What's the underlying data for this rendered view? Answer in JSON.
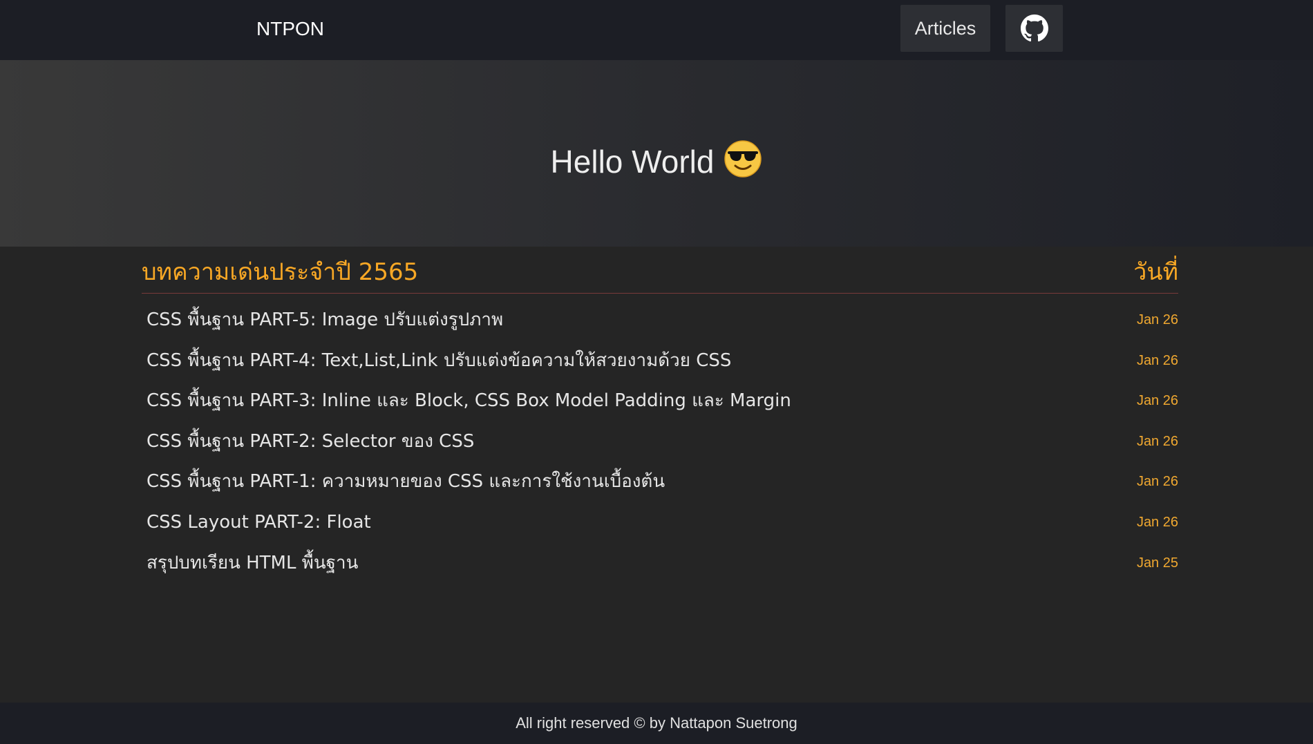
{
  "navbar": {
    "brand": "NTPON",
    "articles_label": "Articles",
    "github_icon": "github-icon"
  },
  "hero": {
    "title": "Hello World",
    "emoji_icon": "smiling-face-with-sunglasses-icon"
  },
  "section": {
    "title": "บทความเด่นประจำปี 2565",
    "date_header": "วันที่"
  },
  "articles": [
    {
      "title": "CSS พื้นฐาน PART-5: Image ปรับแต่งรูปภาพ",
      "date": "Jan 26"
    },
    {
      "title": "CSS พื้นฐาน PART-4: Text,List,Link ปรับแต่งข้อความให้สวยงามด้วย CSS",
      "date": "Jan 26"
    },
    {
      "title": "CSS พื้นฐาน PART-3: Inline และ Block, CSS Box Model Padding และ Margin",
      "date": "Jan 26"
    },
    {
      "title": "CSS พื้นฐาน PART-2: Selector ของ CSS",
      "date": "Jan 26"
    },
    {
      "title": "CSS พื้นฐาน PART-1: ความหมายของ CSS และการใช้งานเบื้องต้น",
      "date": "Jan 26"
    },
    {
      "title": "CSS Layout PART-2: Float",
      "date": "Jan 26"
    },
    {
      "title": "สรุปบทเรียน HTML พื้นฐาน",
      "date": "Jan 25"
    }
  ],
  "footer": {
    "text": "All right reserved © by Nattapon Suetrong"
  },
  "colors": {
    "navbar_bg": "#1c1e25",
    "content_bg": "#252525",
    "accent": "#f9a825",
    "divider": "#7a3b3b"
  }
}
